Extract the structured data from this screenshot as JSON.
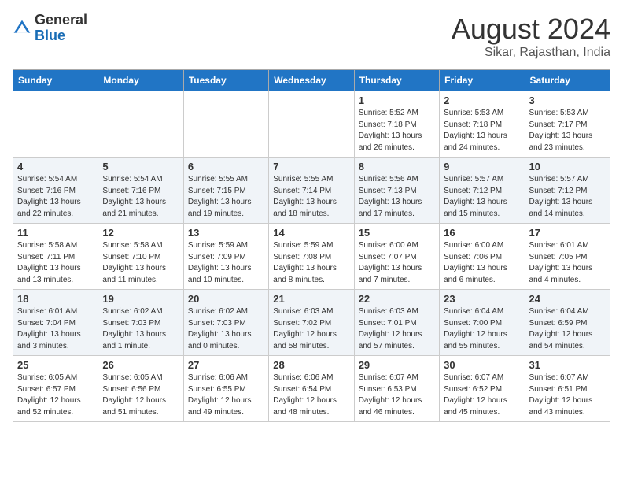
{
  "header": {
    "logo_general": "General",
    "logo_blue": "Blue",
    "month": "August 2024",
    "location": "Sikar, Rajasthan, India"
  },
  "weekdays": [
    "Sunday",
    "Monday",
    "Tuesday",
    "Wednesday",
    "Thursday",
    "Friday",
    "Saturday"
  ],
  "weeks": [
    [
      {
        "day": "",
        "sunrise": "",
        "sunset": "",
        "daylight": ""
      },
      {
        "day": "",
        "sunrise": "",
        "sunset": "",
        "daylight": ""
      },
      {
        "day": "",
        "sunrise": "",
        "sunset": "",
        "daylight": ""
      },
      {
        "day": "",
        "sunrise": "",
        "sunset": "",
        "daylight": ""
      },
      {
        "day": "1",
        "sunrise": "Sunrise: 5:52 AM",
        "sunset": "Sunset: 7:18 PM",
        "daylight": "Daylight: 13 hours and 26 minutes."
      },
      {
        "day": "2",
        "sunrise": "Sunrise: 5:53 AM",
        "sunset": "Sunset: 7:18 PM",
        "daylight": "Daylight: 13 hours and 24 minutes."
      },
      {
        "day": "3",
        "sunrise": "Sunrise: 5:53 AM",
        "sunset": "Sunset: 7:17 PM",
        "daylight": "Daylight: 13 hours and 23 minutes."
      }
    ],
    [
      {
        "day": "4",
        "sunrise": "Sunrise: 5:54 AM",
        "sunset": "Sunset: 7:16 PM",
        "daylight": "Daylight: 13 hours and 22 minutes."
      },
      {
        "day": "5",
        "sunrise": "Sunrise: 5:54 AM",
        "sunset": "Sunset: 7:16 PM",
        "daylight": "Daylight: 13 hours and 21 minutes."
      },
      {
        "day": "6",
        "sunrise": "Sunrise: 5:55 AM",
        "sunset": "Sunset: 7:15 PM",
        "daylight": "Daylight: 13 hours and 19 minutes."
      },
      {
        "day": "7",
        "sunrise": "Sunrise: 5:55 AM",
        "sunset": "Sunset: 7:14 PM",
        "daylight": "Daylight: 13 hours and 18 minutes."
      },
      {
        "day": "8",
        "sunrise": "Sunrise: 5:56 AM",
        "sunset": "Sunset: 7:13 PM",
        "daylight": "Daylight: 13 hours and 17 minutes."
      },
      {
        "day": "9",
        "sunrise": "Sunrise: 5:57 AM",
        "sunset": "Sunset: 7:12 PM",
        "daylight": "Daylight: 13 hours and 15 minutes."
      },
      {
        "day": "10",
        "sunrise": "Sunrise: 5:57 AM",
        "sunset": "Sunset: 7:12 PM",
        "daylight": "Daylight: 13 hours and 14 minutes."
      }
    ],
    [
      {
        "day": "11",
        "sunrise": "Sunrise: 5:58 AM",
        "sunset": "Sunset: 7:11 PM",
        "daylight": "Daylight: 13 hours and 13 minutes."
      },
      {
        "day": "12",
        "sunrise": "Sunrise: 5:58 AM",
        "sunset": "Sunset: 7:10 PM",
        "daylight": "Daylight: 13 hours and 11 minutes."
      },
      {
        "day": "13",
        "sunrise": "Sunrise: 5:59 AM",
        "sunset": "Sunset: 7:09 PM",
        "daylight": "Daylight: 13 hours and 10 minutes."
      },
      {
        "day": "14",
        "sunrise": "Sunrise: 5:59 AM",
        "sunset": "Sunset: 7:08 PM",
        "daylight": "Daylight: 13 hours and 8 minutes."
      },
      {
        "day": "15",
        "sunrise": "Sunrise: 6:00 AM",
        "sunset": "Sunset: 7:07 PM",
        "daylight": "Daylight: 13 hours and 7 minutes."
      },
      {
        "day": "16",
        "sunrise": "Sunrise: 6:00 AM",
        "sunset": "Sunset: 7:06 PM",
        "daylight": "Daylight: 13 hours and 6 minutes."
      },
      {
        "day": "17",
        "sunrise": "Sunrise: 6:01 AM",
        "sunset": "Sunset: 7:05 PM",
        "daylight": "Daylight: 13 hours and 4 minutes."
      }
    ],
    [
      {
        "day": "18",
        "sunrise": "Sunrise: 6:01 AM",
        "sunset": "Sunset: 7:04 PM",
        "daylight": "Daylight: 13 hours and 3 minutes."
      },
      {
        "day": "19",
        "sunrise": "Sunrise: 6:02 AM",
        "sunset": "Sunset: 7:03 PM",
        "daylight": "Daylight: 13 hours and 1 minute."
      },
      {
        "day": "20",
        "sunrise": "Sunrise: 6:02 AM",
        "sunset": "Sunset: 7:03 PM",
        "daylight": "Daylight: 13 hours and 0 minutes."
      },
      {
        "day": "21",
        "sunrise": "Sunrise: 6:03 AM",
        "sunset": "Sunset: 7:02 PM",
        "daylight": "Daylight: 12 hours and 58 minutes."
      },
      {
        "day": "22",
        "sunrise": "Sunrise: 6:03 AM",
        "sunset": "Sunset: 7:01 PM",
        "daylight": "Daylight: 12 hours and 57 minutes."
      },
      {
        "day": "23",
        "sunrise": "Sunrise: 6:04 AM",
        "sunset": "Sunset: 7:00 PM",
        "daylight": "Daylight: 12 hours and 55 minutes."
      },
      {
        "day": "24",
        "sunrise": "Sunrise: 6:04 AM",
        "sunset": "Sunset: 6:59 PM",
        "daylight": "Daylight: 12 hours and 54 minutes."
      }
    ],
    [
      {
        "day": "25",
        "sunrise": "Sunrise: 6:05 AM",
        "sunset": "Sunset: 6:57 PM",
        "daylight": "Daylight: 12 hours and 52 minutes."
      },
      {
        "day": "26",
        "sunrise": "Sunrise: 6:05 AM",
        "sunset": "Sunset: 6:56 PM",
        "daylight": "Daylight: 12 hours and 51 minutes."
      },
      {
        "day": "27",
        "sunrise": "Sunrise: 6:06 AM",
        "sunset": "Sunset: 6:55 PM",
        "daylight": "Daylight: 12 hours and 49 minutes."
      },
      {
        "day": "28",
        "sunrise": "Sunrise: 6:06 AM",
        "sunset": "Sunset: 6:54 PM",
        "daylight": "Daylight: 12 hours and 48 minutes."
      },
      {
        "day": "29",
        "sunrise": "Sunrise: 6:07 AM",
        "sunset": "Sunset: 6:53 PM",
        "daylight": "Daylight: 12 hours and 46 minutes."
      },
      {
        "day": "30",
        "sunrise": "Sunrise: 6:07 AM",
        "sunset": "Sunset: 6:52 PM",
        "daylight": "Daylight: 12 hours and 45 minutes."
      },
      {
        "day": "31",
        "sunrise": "Sunrise: 6:07 AM",
        "sunset": "Sunset: 6:51 PM",
        "daylight": "Daylight: 12 hours and 43 minutes."
      }
    ]
  ]
}
